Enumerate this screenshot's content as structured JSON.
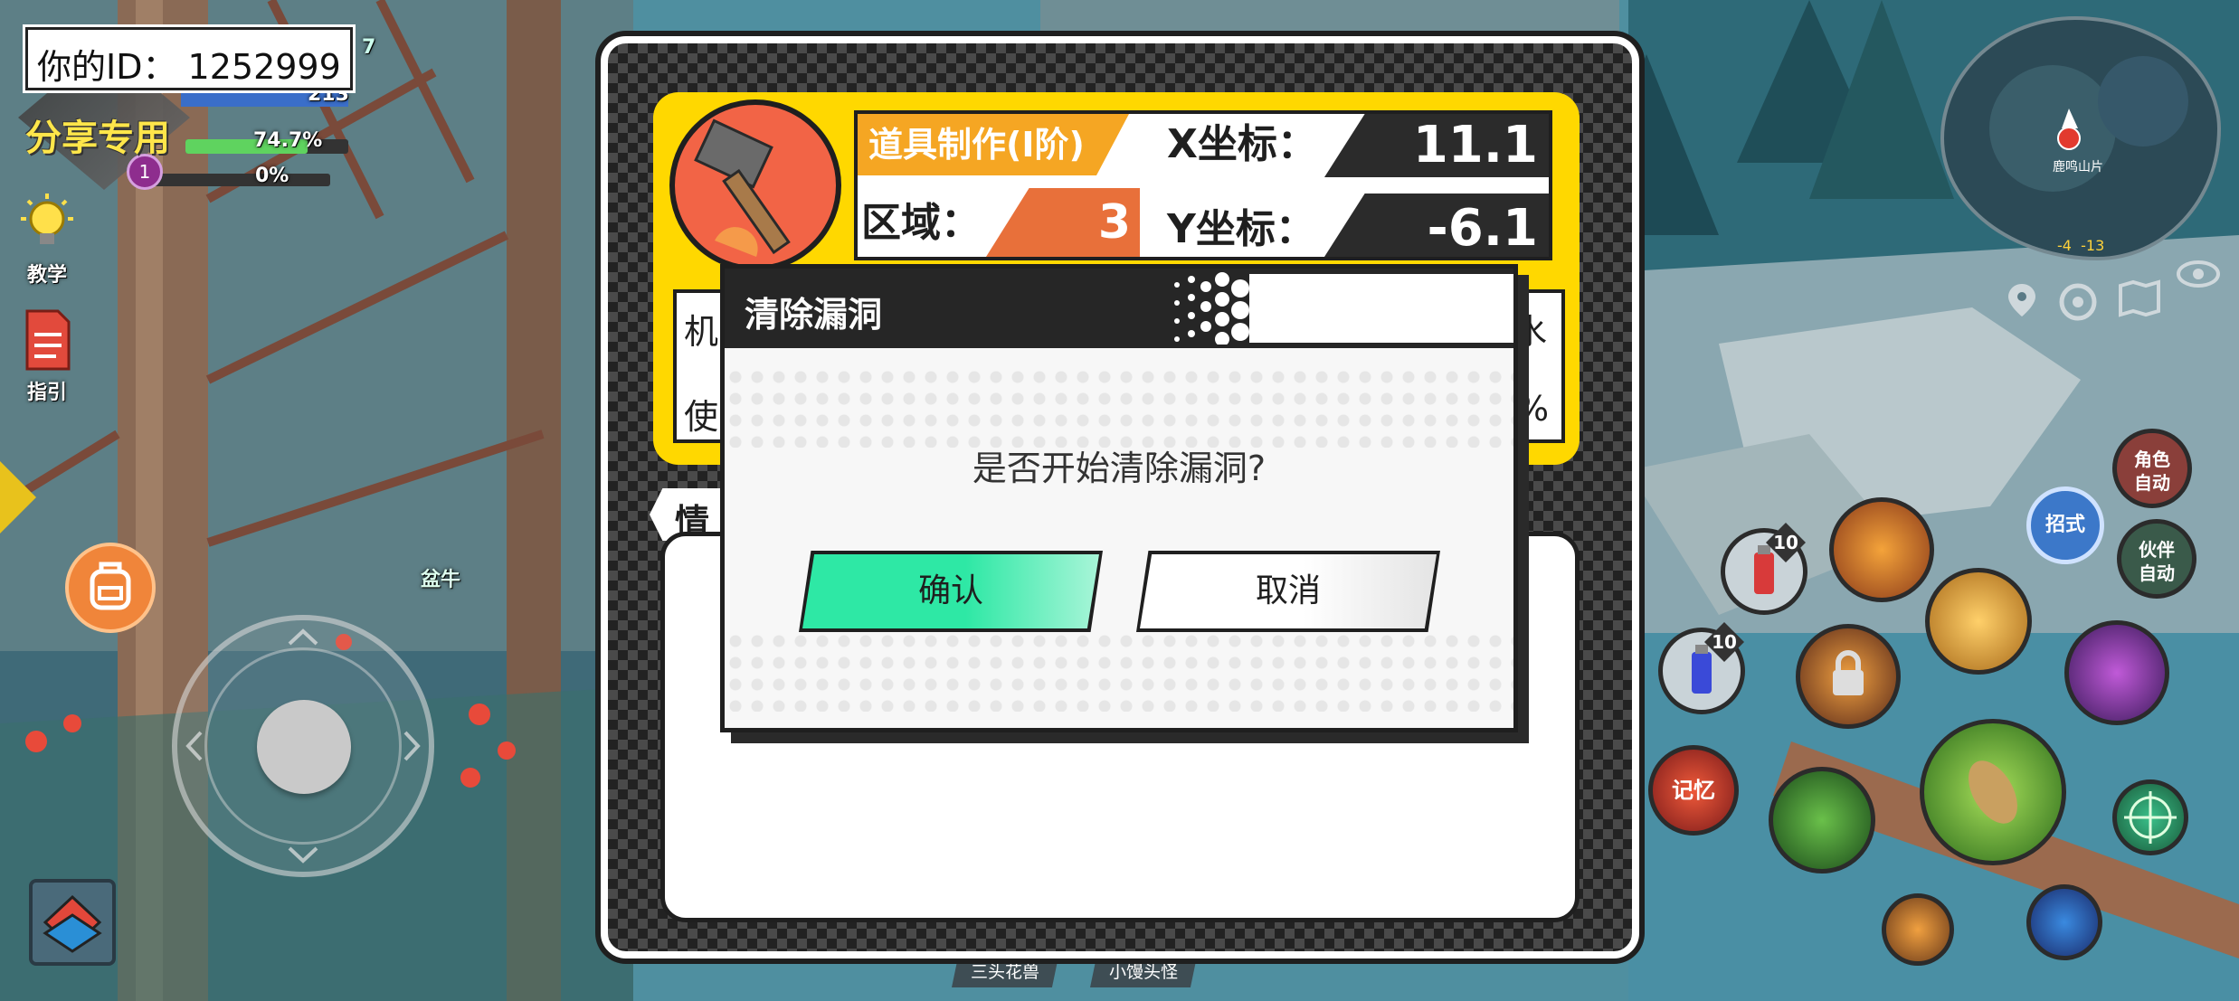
{
  "player": {
    "id_label": "你的ID：  1252999",
    "share_label": "分享专用",
    "level": "1",
    "hp_text": "74.7%",
    "xp_text": "0%",
    "top_num_a": "7",
    "top_num_b": "213"
  },
  "left_menu": {
    "tutorial": "教学",
    "guide": "指引"
  },
  "panel": {
    "craft_label": "道具制作(Ⅰ阶)",
    "region_label": "区域：",
    "region_value": "3",
    "x_label": "X坐标：",
    "x_value": "11.1",
    "y_label": "Y坐标：",
    "y_value": "-6.1",
    "row1_left": "机",
    "row2_left": "使",
    "row1_right": "水",
    "row2_right": "%",
    "info_tab": "情"
  },
  "dialog": {
    "title": "清除漏洞",
    "message": "是否开始清除漏洞?",
    "confirm": "确认",
    "cancel": "取消"
  },
  "minimap": {
    "coords": "-4  -13",
    "poi_label": "鹿鸣山片"
  },
  "skills": {
    "role_auto": "角色\n自动",
    "partner_auto": "伙伴\n自动",
    "ultimate": "招式",
    "memory": "记忆",
    "potion_red_count": "10",
    "potion_blue_count": "10"
  },
  "bottom_tags": [
    "三头花兽",
    "小馒头怪"
  ],
  "world_label": "盆牛",
  "colors": {
    "accent_yellow": "#ffd800",
    "accent_orange": "#f5a623",
    "region_orange": "#e8703a",
    "confirm_green": "#2ee8a5",
    "panel_dark": "#1f1f1f"
  }
}
